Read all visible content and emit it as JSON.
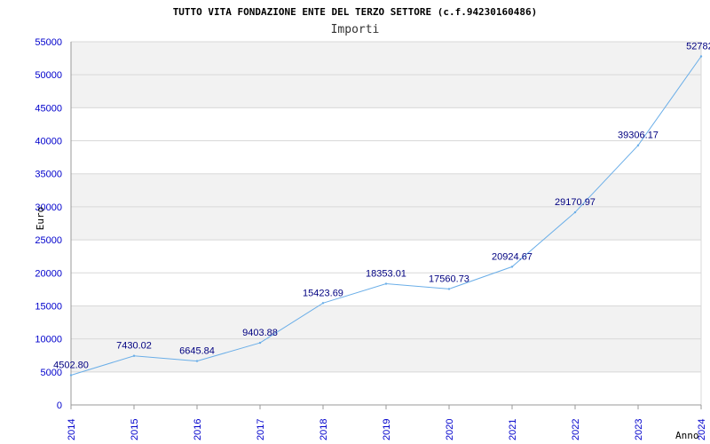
{
  "chart_data": {
    "type": "line",
    "title": "TUTTO VITA FONDAZIONE ENTE DEL TERZO SETTORE (c.f.94230160486)",
    "subtitle": "Importi",
    "xlabel": "Anno",
    "ylabel": "Euro",
    "x": [
      "2014",
      "2015",
      "2016",
      "2017",
      "2018",
      "2019",
      "2020",
      "2021",
      "2022",
      "2023",
      "2024"
    ],
    "values": [
      4502.8,
      7430.02,
      6645.84,
      9403.88,
      15423.69,
      18353.01,
      17560.73,
      20924.67,
      29170.97,
      39306.17,
      52782.0
    ],
    "data_labels": [
      "4502.80",
      "7430.02",
      "6645.84",
      "9403.88",
      "15423.69",
      "18353.01",
      "17560.73",
      "20924.67",
      "29170.97",
      "39306.17",
      "52782."
    ],
    "yticks": [
      0,
      5000,
      10000,
      15000,
      20000,
      25000,
      30000,
      35000,
      40000,
      45000,
      50000,
      55000
    ],
    "ylim": [
      0,
      55000
    ],
    "grid": true,
    "colors": {
      "line": "#6aaee8",
      "band": "#f2f2f2",
      "grid": "#d8d8d8",
      "tick": "#0000cc",
      "label": "#000080"
    }
  }
}
